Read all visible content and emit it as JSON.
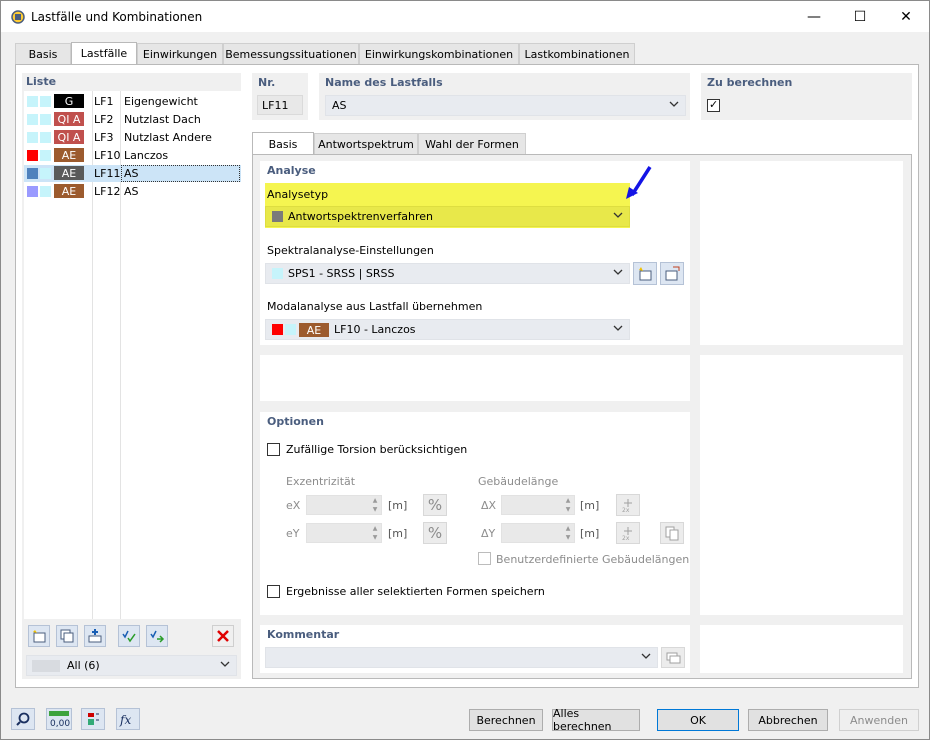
{
  "window": {
    "title": "Lastfälle und Kombinationen",
    "minimize": "—",
    "maximize": "☐",
    "close": "✕"
  },
  "main_tabs": [
    "Basis",
    "Lastfälle",
    "Einwirkungen",
    "Bemessungssituationen",
    "Einwirkungskombinationen",
    "Lastkombinationen"
  ],
  "active_main_tab": "Lastfälle",
  "list": {
    "title": "Liste",
    "items": [
      {
        "color": "#c6f4fb",
        "tag": "G",
        "tag_color": "#000000",
        "id": "LF1",
        "name": "Eigengewicht"
      },
      {
        "color": "#c6f4fb",
        "tag": "QI A",
        "tag_color": "#c0504d",
        "id": "LF2",
        "name": "Nutzlast Dach"
      },
      {
        "color": "#c6f4fb",
        "tag": "QI A",
        "tag_color": "#c0504d",
        "id": "LF3",
        "name": "Nutzlast Andere"
      },
      {
        "color": "#ff0000",
        "tag": "AE",
        "tag_color": "#9c5b2e",
        "id": "LF10",
        "name": "Lanczos"
      },
      {
        "color": "#4f81bd",
        "tag": "AE",
        "tag_color": "#5a5a5a",
        "id": "LF11",
        "name": "AS"
      },
      {
        "color": "#9a9aff",
        "tag": "AE",
        "tag_color": "#9c5b2e",
        "id": "LF12",
        "name": "AS"
      }
    ],
    "selected_index": 4,
    "filter": "All (6)"
  },
  "header": {
    "nr_label": "Nr.",
    "nr_value": "LF11",
    "name_label": "Name des Lastfalls",
    "name_value": "AS",
    "calc_label": "Zu berechnen",
    "calc_checked": "✓"
  },
  "sub_tabs": [
    "Basis",
    "Antwortspektrum",
    "Wahl der Formen"
  ],
  "active_sub_tab": "Basis",
  "analyse": {
    "title": "Analyse",
    "type_label": "Analysetyp",
    "type_value": "Antwortspektrenverfahren",
    "spectral_label": "Spektralanalyse-Einstellungen",
    "spectral_value": "SPS1 - SRSS | SRSS",
    "modal_label": "Modalanalyse aus Lastfall übernehmen",
    "modal_tag": "AE",
    "modal_value": "LF10 - Lanczos"
  },
  "optionen": {
    "title": "Optionen",
    "torsion_label": "Zufällige Torsion berücksichtigen",
    "exzentr_label": "Exzentrizität",
    "ex_label": "eX",
    "ey_label": "eY",
    "unit_m": "[m]",
    "percent": "%",
    "gebaeude_label": "Gebäudelänge",
    "dx_label": "ΔX",
    "dy_label": "ΔY",
    "custom_label": "Benutzerdefinierte Gebäudelängen",
    "save_label": "Ergebnisse aller selektierten Formen speichern"
  },
  "kommentar": {
    "title": "Kommentar"
  },
  "footer": {
    "berechnen": "Berechnen",
    "alles_berechnen": "Alles berechnen",
    "ok": "OK",
    "abbrechen": "Abbrechen",
    "anwenden": "Anwenden",
    "units_icon_text": "0,00"
  },
  "colors": {
    "accent_blue": "#0078d7",
    "highlight_yellow": "#f5f550",
    "section_title": "#4a5d7e",
    "arrow_blue": "#1414e6"
  }
}
